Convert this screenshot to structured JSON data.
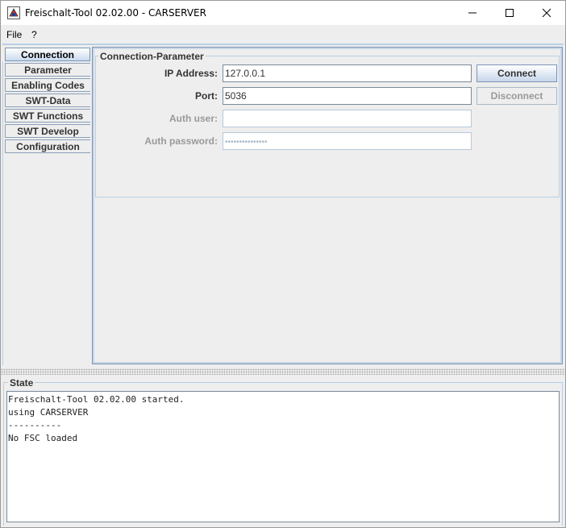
{
  "window": {
    "title": "Freischalt-Tool 02.02.00 - CARSERVER",
    "icons": {
      "app": "java-app-icon",
      "minimize": "minimize-icon",
      "maximize": "maximize-icon",
      "close": "close-icon"
    }
  },
  "menu": [
    {
      "label": "File"
    },
    {
      "label": "?"
    }
  ],
  "tabs": [
    {
      "label": "Connection",
      "selected": true
    },
    {
      "label": "Parameter"
    },
    {
      "label": "Enabling Codes"
    },
    {
      "label": "SWT-Data"
    },
    {
      "label": "SWT Functions"
    },
    {
      "label": "SWT Develop"
    },
    {
      "label": "Configuration"
    }
  ],
  "connection": {
    "group_title": "Connection-Parameter",
    "ip_label": "IP Address:",
    "ip_value": "127.0.0.1",
    "port_label": "Port:",
    "port_value": "5036",
    "auth_user_label": "Auth user:",
    "auth_user_value": "",
    "auth_password_label": "Auth password:",
    "auth_password_value": "•••••••••••••••",
    "connect_label": "Connect",
    "disconnect_label": "Disconnect"
  },
  "state": {
    "title": "State",
    "lines": [
      "Freischalt-Tool 02.02.00 started.",
      "using CARSERVER",
      "----------",
      "No FSC loaded"
    ]
  },
  "colors": {
    "accent_border": "#7a94b5",
    "light_border": "#b8cfe5",
    "background": "#eeeeee"
  }
}
